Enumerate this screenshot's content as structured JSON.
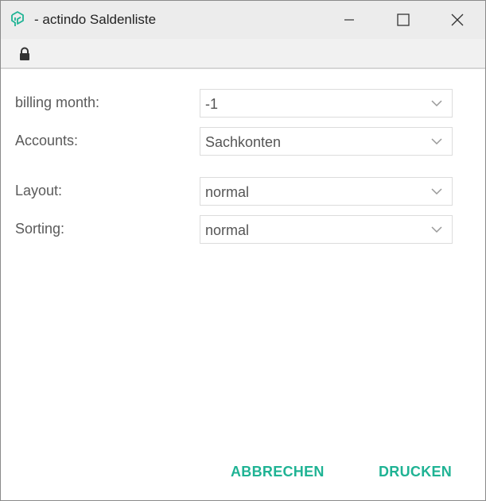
{
  "window": {
    "title": "- actindo Saldenliste",
    "app_icon": "actindo-logo-icon",
    "accent_color": "#1fb394"
  },
  "addressbar": {
    "icon": "lock-icon"
  },
  "form": {
    "billing_month": {
      "label": "billing month:",
      "value": "-1"
    },
    "accounts": {
      "label": "Accounts:",
      "value": "Sachkonten"
    },
    "layout": {
      "label": "Layout:",
      "value": "normal"
    },
    "sorting": {
      "label": "Sorting:",
      "value": "normal"
    }
  },
  "actions": {
    "cancel_label": "ABBRECHEN",
    "print_label": "DRUCKEN"
  }
}
